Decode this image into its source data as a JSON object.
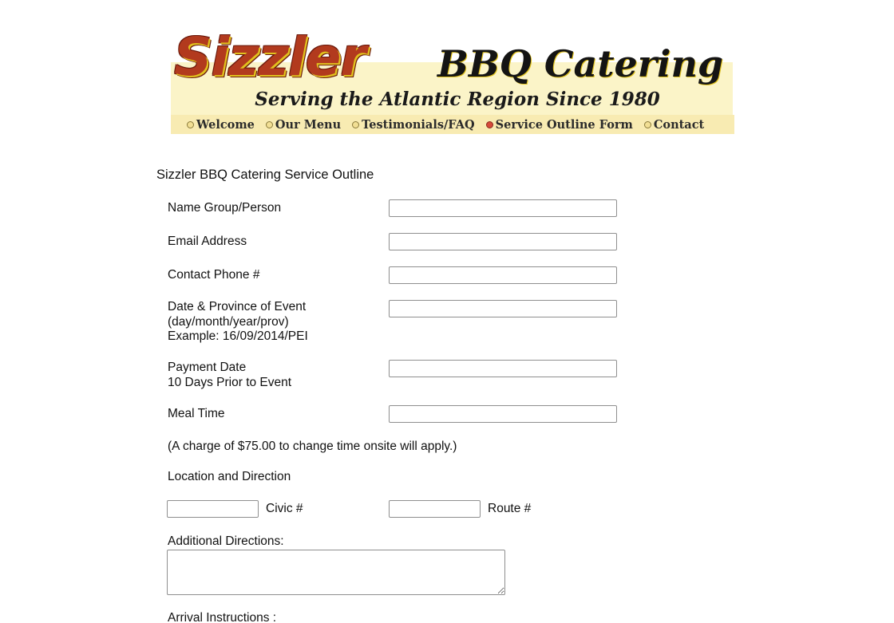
{
  "header": {
    "logo_word": "Sizzler",
    "logo_sub": "BBQ Catering",
    "tagline": "Serving the Atlantic Region Since 1980",
    "nav": [
      {
        "label": "Welcome"
      },
      {
        "label": "Our Menu"
      },
      {
        "label": "Testimonials/FAQ"
      },
      {
        "label": "Service Outline Form",
        "active": true
      },
      {
        "label": "Contact"
      }
    ]
  },
  "form": {
    "title": "Sizzler BBQ Catering Service Outline",
    "name_label": "Name Group/Person",
    "name_value": "",
    "email_label": "Email Address",
    "email_value": "",
    "phone_label": "Contact Phone #",
    "phone_value": "",
    "date_label_1": "Date & Province of Event",
    "date_label_2": "(day/month/year/prov)",
    "date_label_3": "Example: 16/09/2014/PEI",
    "date_value": "",
    "payment_label_1": "Payment Date",
    "payment_label_2": "10 Days Prior to Event",
    "payment_value": "",
    "meal_label": "Meal Time",
    "meal_value": "",
    "charge_note": "(A charge of $75.00 to change time onsite will apply.)",
    "location_label": "Location and Direction",
    "civic_label": "Civic #",
    "civic_value": "",
    "route_label": "Route #",
    "route_value": "",
    "additional_label": "Additional Directions:",
    "additional_value": "",
    "arrival_label": "Arrival Instructions :"
  },
  "colors": {
    "logo_red": "#b23a1e",
    "logo_gold": "#e1c21e",
    "banner_cream": "#fbf4c8",
    "nav_bg": "#f8ebb2",
    "active_bullet": "#d64a3a"
  }
}
